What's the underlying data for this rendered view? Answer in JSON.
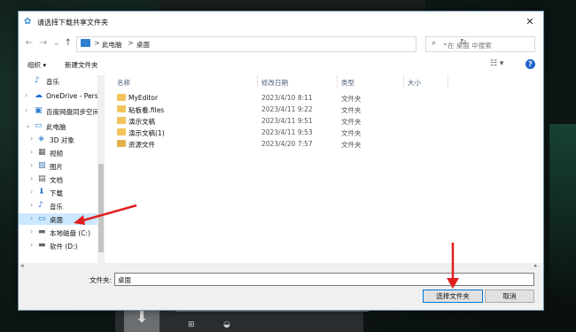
{
  "dialog": {
    "title": "请选择下载共享文件夹",
    "close_glyph": "✕"
  },
  "address": {
    "segments": [
      "此电脑",
      "桌面"
    ],
    "separator": ">",
    "dropdown_glyph": "⌄",
    "refresh_glyph": "↻"
  },
  "nav": {
    "back": "←",
    "forward": "→",
    "recent": "⌄",
    "up": "↑"
  },
  "search": {
    "placeholder": "在 桌面 中搜索",
    "icon": "⌕"
  },
  "toolbar": {
    "organize": "组织 ▾",
    "new_folder": "新建文件夹",
    "view_glyph": "☷ ▾",
    "help": "?"
  },
  "sidebar": {
    "items": [
      {
        "arrow": "",
        "icon": "♪",
        "label": "音乐"
      },
      {
        "arrow": "›",
        "icon": "☁",
        "label": "OneDrive - Perso"
      },
      {
        "arrow": "›",
        "icon": "▣",
        "label": "百度网盘同步空间"
      },
      {
        "arrow": "⌄",
        "icon": "▭",
        "label": "此电脑"
      },
      {
        "arrow": "›",
        "icon": "◈",
        "label": "3D 对象"
      },
      {
        "arrow": "›",
        "icon": "▦",
        "label": "视频"
      },
      {
        "arrow": "›",
        "icon": "▨",
        "label": "图片"
      },
      {
        "arrow": "›",
        "icon": "▤",
        "label": "文档"
      },
      {
        "arrow": "›",
        "icon": "⬇",
        "label": "下载"
      },
      {
        "arrow": "›",
        "icon": "♪",
        "label": "音乐"
      },
      {
        "arrow": "›",
        "icon": "▭",
        "label": "桌面"
      },
      {
        "arrow": "›",
        "icon": "▬",
        "label": "本地磁盘 (C:)"
      },
      {
        "arrow": "›",
        "icon": "▬",
        "label": "软件 (D:)"
      }
    ]
  },
  "columns": {
    "name": "名称",
    "date": "修改日期",
    "type": "类型",
    "size": "大小"
  },
  "files": [
    {
      "name": "MyEditor",
      "date": "2023/4/10 8:11",
      "type": "文件夹"
    },
    {
      "name": "粘板看.files",
      "date": "2023/4/11 9:22",
      "type": "文件夹"
    },
    {
      "name": "演示文稿",
      "date": "2023/4/11 9:51",
      "type": "文件夹"
    },
    {
      "name": "演示文稿(1)",
      "date": "2023/4/11 9:53",
      "type": "文件夹"
    },
    {
      "name": "资源文件",
      "date": "2023/4/20 7:57",
      "type": "文件夹"
    }
  ],
  "footer": {
    "filename_label": "文件夹:",
    "filename_value": "桌面",
    "select_button": "选择文件夹",
    "cancel_button": "取消"
  },
  "colors": {
    "accent": "#0078d7",
    "selection": "#cce8ff",
    "folder": "#f2c55c",
    "annotation": "#e02020"
  }
}
